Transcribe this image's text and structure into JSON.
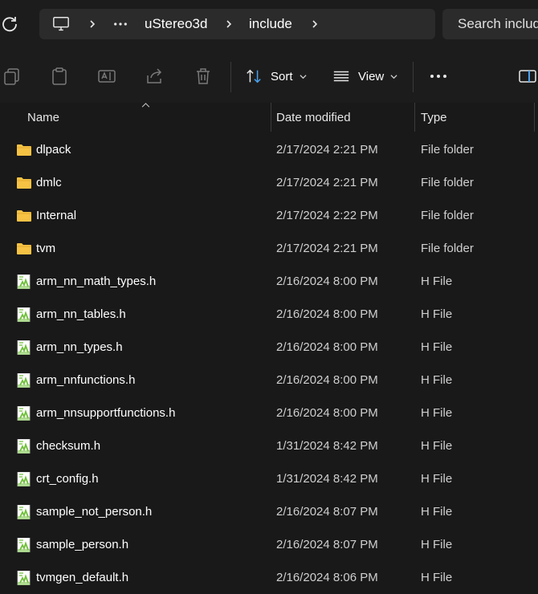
{
  "breadcrumb": {
    "items": [
      "uStereo3d",
      "include"
    ]
  },
  "search": {
    "placeholder": "Search includ"
  },
  "toolbar": {
    "sort_label": "Sort",
    "view_label": "View"
  },
  "columns": {
    "name": "Name",
    "date": "Date modified",
    "type": "Type"
  },
  "rows": [
    {
      "name": "dlpack",
      "date": "2/17/2024 2:21 PM",
      "type": "File folder",
      "icon": "folder-icon"
    },
    {
      "name": "dmlc",
      "date": "2/17/2024 2:21 PM",
      "type": "File folder",
      "icon": "folder-icon"
    },
    {
      "name": "Internal",
      "date": "2/17/2024 2:22 PM",
      "type": "File folder",
      "icon": "folder-icon"
    },
    {
      "name": "tvm",
      "date": "2/17/2024 2:21 PM",
      "type": "File folder",
      "icon": "folder-icon"
    },
    {
      "name": "arm_nn_math_types.h",
      "date": "2/16/2024 8:00 PM",
      "type": "H File",
      "icon": "header-file-icon"
    },
    {
      "name": "arm_nn_tables.h",
      "date": "2/16/2024 8:00 PM",
      "type": "H File",
      "icon": "header-file-icon"
    },
    {
      "name": "arm_nn_types.h",
      "date": "2/16/2024 8:00 PM",
      "type": "H File",
      "icon": "header-file-icon"
    },
    {
      "name": "arm_nnfunctions.h",
      "date": "2/16/2024 8:00 PM",
      "type": "H File",
      "icon": "header-file-icon"
    },
    {
      "name": "arm_nnsupportfunctions.h",
      "date": "2/16/2024 8:00 PM",
      "type": "H File",
      "icon": "header-file-icon"
    },
    {
      "name": "checksum.h",
      "date": "1/31/2024 8:42 PM",
      "type": "H File",
      "icon": "header-file-icon"
    },
    {
      "name": "crt_config.h",
      "date": "1/31/2024 8:42 PM",
      "type": "H File",
      "icon": "header-file-icon"
    },
    {
      "name": "sample_not_person.h",
      "date": "2/16/2024 8:07 PM",
      "type": "H File",
      "icon": "header-file-icon"
    },
    {
      "name": "sample_person.h",
      "date": "2/16/2024 8:07 PM",
      "type": "H File",
      "icon": "header-file-icon"
    },
    {
      "name": "tvmgen_default.h",
      "date": "2/16/2024 8:06 PM",
      "type": "H File",
      "icon": "header-file-icon"
    }
  ],
  "colors": {
    "background": "#191919",
    "folder": "#f6c244",
    "file_accent": "#6fbf3a"
  }
}
